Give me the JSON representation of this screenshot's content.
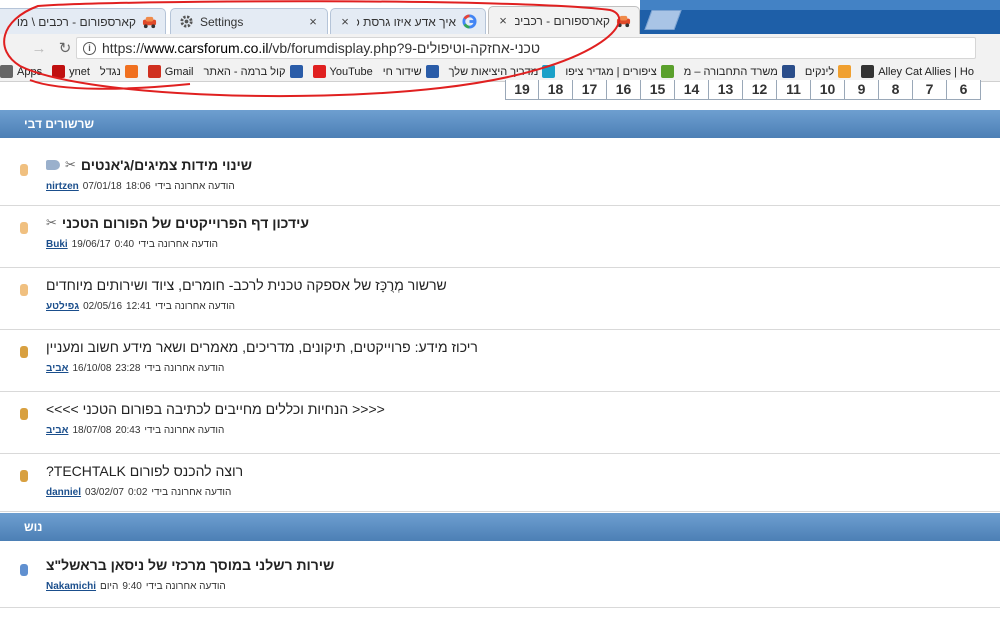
{
  "browser": {
    "tabs": [
      {
        "title": "קארספורום - רכבים \\ מו",
        "icon": "car-icon",
        "active": false
      },
      {
        "title": "Settings",
        "icon": "gear-icon",
        "active": false
      },
      {
        "title": "איך אדע איזו גרסת כרום",
        "icon": "google-icon",
        "active": false
      },
      {
        "title": "קארספורום - רכבים \\ מו",
        "icon": "car-icon",
        "active": true
      }
    ],
    "close_glyph": "×",
    "url_prefix": "https://",
    "url_domain": "www.carsforum.co.il",
    "url_path": "/vb/forumdisplay.php?9-",
    "url_hebrew": "טכני-אחזקה-וטיפולים",
    "bookmarks": [
      {
        "label": "Alley Cat Allies | Ho",
        "icon": "paw-icon",
        "color": "#333333"
      },
      {
        "label": "לינקים",
        "icon": "link-icon",
        "color": "#f0a030"
      },
      {
        "label": "משרד התחבורה – מ",
        "icon": "ministry-icon",
        "color": "#2a4d8a"
      },
      {
        "label": "ציפורים | מגדיר ציפו",
        "icon": "bird-icon",
        "color": "#5aa02c"
      },
      {
        "label": "מדריך היציאות שלך",
        "icon": "guide-icon",
        "color": "#1aa0c8"
      },
      {
        "label": "שידור חי",
        "icon": "tv-icon",
        "color": "#2a5ca8"
      },
      {
        "label": "YouTube",
        "icon": "youtube-icon",
        "color": "#e02020"
      },
      {
        "label": "קול ברמה - האתר",
        "icon": "radio-icon",
        "color": "#2a5ca8"
      },
      {
        "label": "Gmail",
        "icon": "gmail-icon",
        "color": "#d03020"
      },
      {
        "label": "נגדל",
        "icon": "blogger-icon",
        "color": "#f07020"
      },
      {
        "label": "ynet",
        "icon": "ynet-icon",
        "color": "#c01010"
      },
      {
        "label": "Apps",
        "icon": "apps-icon",
        "color": "#666666"
      }
    ]
  },
  "pages": [
    "6",
    "7",
    "8",
    "9",
    "10",
    "11",
    "12",
    "13",
    "14",
    "15",
    "16",
    "17",
    "18",
    "19"
  ],
  "sections": [
    {
      "label": "שרשורים דבי"
    },
    {
      "label": "נוש"
    }
  ],
  "threads": [
    {
      "title": "שינוי מידות צמיגים/ג'אנטים",
      "bold": true,
      "user": "nirtzen",
      "date": "07/01/18",
      "time": "18:06",
      "label": "הודעה אחרונה בידי",
      "clip": true,
      "tag": true,
      "edge_color": "#f0c080"
    },
    {
      "title": "עידכון דף הפרוייקטים של הפורום הטכני",
      "bold": true,
      "user": "Buki",
      "date": "19/06/17",
      "time": "0:40",
      "label": "הודעה אחרונה בידי",
      "clip": true,
      "tag": false,
      "edge_color": "#f0c080"
    },
    {
      "title": "שרשור מְרֻכָּז של אספקה טכנית לרכב- חומרים, ציוד ושירותים מיוחדים",
      "bold": false,
      "user": "גפילטע",
      "date": "02/05/16",
      "time": "12:41",
      "label": "הודעה אחרונה בידי",
      "clip": false,
      "tag": false,
      "edge_color": "#f0c080"
    },
    {
      "title": "ריכוז מידע: פרוייקטים, תיקונים, מדריכים, מאמרים ושאר מידע חשוב ומעניין",
      "bold": false,
      "user": "אביב",
      "date": "16/10/08",
      "time": "23:28",
      "label": "הודעה אחרונה בידי",
      "clip": false,
      "tag": false,
      "edge_color": "#d8a040"
    },
    {
      "title": "<<<< הנחיות וכללים מחייבים לכתיבה בפורום הטכני >>>>",
      "bold": false,
      "user": "אביב",
      "date": "18/07/08",
      "time": "20:43",
      "label": "הודעה אחרונה בידי",
      "clip": false,
      "tag": false,
      "edge_color": "#d8a040"
    },
    {
      "title": "רוצה להכנס לפורום TECHTALK?",
      "bold": false,
      "user": "danniel",
      "date": "03/02/07",
      "time": "0:02",
      "label": "הודעה אחרונה בידי",
      "clip": false,
      "tag": false,
      "edge_color": "#d8a040"
    },
    {
      "title": "שירות רשלני במוסך מרכזי של ניסאן בראשל\"צ",
      "bold": true,
      "user": "Nakamichi",
      "date": "היום",
      "time": "9:40",
      "label": "הודעה אחרונה בידי",
      "clip": false,
      "tag": false,
      "edge_color": "#6090d0"
    }
  ],
  "colors": {
    "section_bar": "#5a8cc0",
    "link": "#1a4e8c",
    "annotation": "#e02020"
  }
}
